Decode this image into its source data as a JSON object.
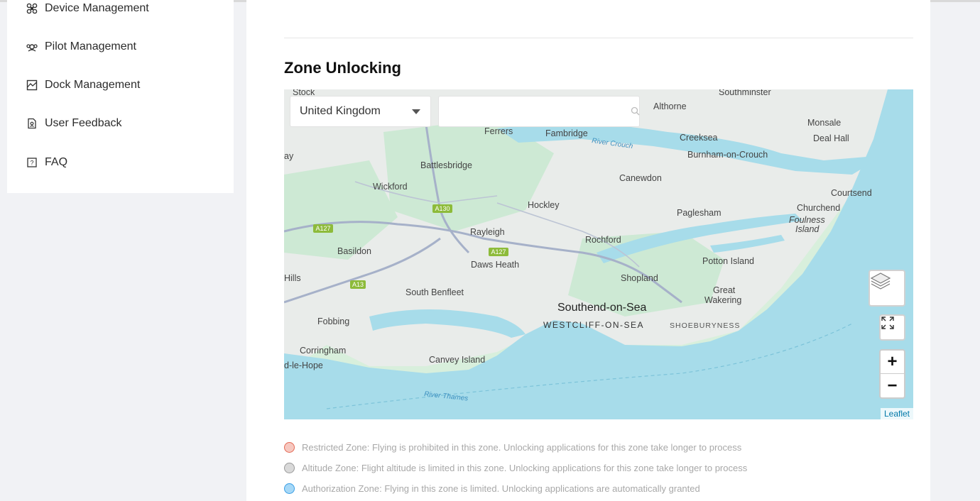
{
  "sidebar": {
    "items": [
      {
        "label": "Device Management",
        "icon": "drone-icon"
      },
      {
        "label": "Pilot Management",
        "icon": "pilot-icon"
      },
      {
        "label": "Dock Management",
        "icon": "dock-icon"
      },
      {
        "label": "User Feedback",
        "icon": "feedback-icon"
      },
      {
        "label": "FAQ",
        "icon": "faq-icon"
      }
    ]
  },
  "main": {
    "title": "Zone Unlocking",
    "country_select": {
      "value": "United Kingdom"
    },
    "search": {
      "placeholder": ""
    },
    "map": {
      "attribution": "Leaflet",
      "places": [
        "Stock",
        "Southminster",
        "Althorne",
        "Ferrers",
        "Fambridge",
        "Monsale",
        "Deal Hall",
        "Creeksea",
        "Burnham-on-Crouch",
        "Battlesbridge",
        "Canewdon",
        "Wickford",
        "Courtsend",
        "Hockley",
        "Churchend",
        "Paglesham",
        "Foulness",
        "Island",
        "Rayleigh",
        "Basildon",
        "Rochford",
        "Daws Heath",
        "Potton Island",
        "Shopland",
        "Hills",
        "South Benfleet",
        "Great",
        "Wakering",
        "Southend-on-Sea",
        "WESTCLIFF-ON-SEA",
        "SHOEBURYNESS",
        "Fobbing",
        "Corringham",
        "Canvey Island",
        "d-le-Hope",
        "ay",
        "River Crouch",
        "River Thames"
      ],
      "roads": [
        "A130",
        "A127",
        "A127",
        "A13"
      ],
      "zoom_in": "+",
      "zoom_out": "−"
    },
    "legend": [
      {
        "label": "Restricted Zone: Flying is prohibited in this zone. Unlocking applications for this zone take longer to process",
        "fill": "#f6c8c0",
        "border": "#e46a55"
      },
      {
        "label": "Altitude Zone: Flight altitude is limited in this zone. Unlocking applications for this zone take longer to process",
        "fill": "#d9d9d9",
        "border": "#9a9a9a"
      },
      {
        "label": "Authorization Zone: Flying in this zone is limited. Unlocking applications are automatically granted",
        "fill": "#a6d8f7",
        "border": "#3a9ee4"
      }
    ]
  }
}
